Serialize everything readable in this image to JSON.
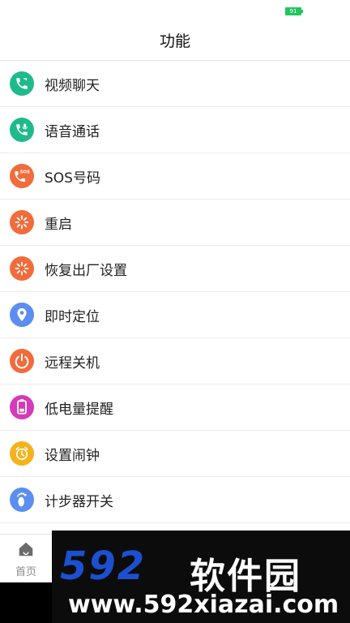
{
  "status_bar": {
    "battery": "91"
  },
  "header": {
    "title": "功能"
  },
  "items": [
    {
      "id": "video-chat",
      "label": "视频聊天",
      "icon": "video-call-icon",
      "color": "#1fba8c"
    },
    {
      "id": "voice-call",
      "label": "语音通话",
      "icon": "voice-call-icon",
      "color": "#1fba8c"
    },
    {
      "id": "sos-number",
      "label": "SOS号码",
      "icon": "sos-phone-icon",
      "color": "#f26b3a"
    },
    {
      "id": "restart",
      "label": "重启",
      "icon": "restart-icon",
      "color": "#f26b3a"
    },
    {
      "id": "factory-reset",
      "label": "恢复出厂设置",
      "icon": "factory-reset-icon",
      "color": "#f26b3a"
    },
    {
      "id": "locate",
      "label": "即时定位",
      "icon": "location-pin-icon",
      "color": "#5b8ef0"
    },
    {
      "id": "remote-shutdown",
      "label": "远程关机",
      "icon": "power-icon",
      "color": "#f26b3a"
    },
    {
      "id": "low-battery",
      "label": "低电量提醒",
      "icon": "battery-icon",
      "color": "#d63ab8"
    },
    {
      "id": "alarm",
      "label": "设置闹钟",
      "icon": "alarm-clock-icon",
      "color": "#f5b21b"
    },
    {
      "id": "pedometer",
      "label": "计步器开关",
      "icon": "footprint-icon",
      "color": "#5b8ef0"
    }
  ],
  "tabbar": {
    "home_label": "首页"
  },
  "watermark": {
    "logo": "592",
    "brand": "软件园",
    "url": "www.592xiazai.com"
  }
}
